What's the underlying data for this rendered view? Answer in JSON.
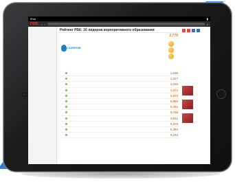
{
  "device": {
    "accent_color": "#2a7fd4",
    "bezel_color": "#1a1b1d"
  },
  "status_bar": {
    "carrier": "iPad",
    "time": "",
    "battery": ""
  },
  "browser": {
    "logo": "FSBL"
  },
  "page": {
    "title": "Рейтинг РБК: 10 лидеров корпоративного образования",
    "top_value": "2,778"
  },
  "company": {
    "logo_text": "ГАЗПРОМ"
  },
  "table_rows": [
    {
      "value": "1,636"
    },
    {
      "value": "1,227"
    },
    {
      "value": "1,025"
    },
    {
      "value": "1,072"
    },
    {
      "value": "0,970"
    },
    {
      "value": "0,869"
    },
    {
      "value": "0,751"
    },
    {
      "value": "0,746"
    },
    {
      "value": "0,511"
    },
    {
      "value": "0,479"
    },
    {
      "value": "0,393"
    },
    {
      "value": "0,243"
    }
  ]
}
